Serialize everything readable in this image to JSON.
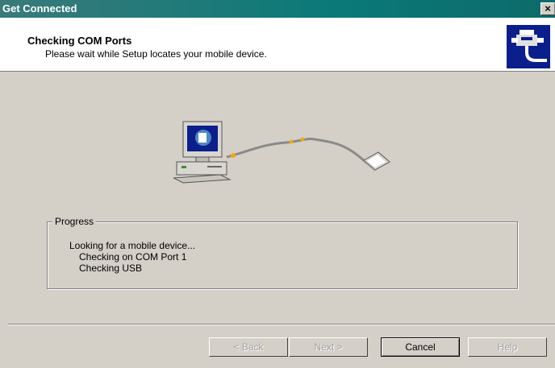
{
  "window": {
    "title": "Get Connected",
    "close_glyph": "×"
  },
  "header": {
    "title": "Checking COM Ports",
    "subtitle": "Please wait while Setup locates your mobile device.",
    "icon": "device-connection-icon"
  },
  "illustration": {
    "icon": "desktop-to-mobile-cable-icon"
  },
  "progress": {
    "legend": "Progress",
    "lines": [
      "Looking for a mobile device...",
      "Checking on COM Port 1",
      "Checking USB"
    ]
  },
  "buttons": {
    "back": "< Back",
    "next": "Next >",
    "cancel": "Cancel",
    "help": "Help"
  },
  "colors": {
    "titlebar": "#0a7a78",
    "dialog_face": "#d4d0c8",
    "header_icon_bg": "#0a1f8c"
  }
}
